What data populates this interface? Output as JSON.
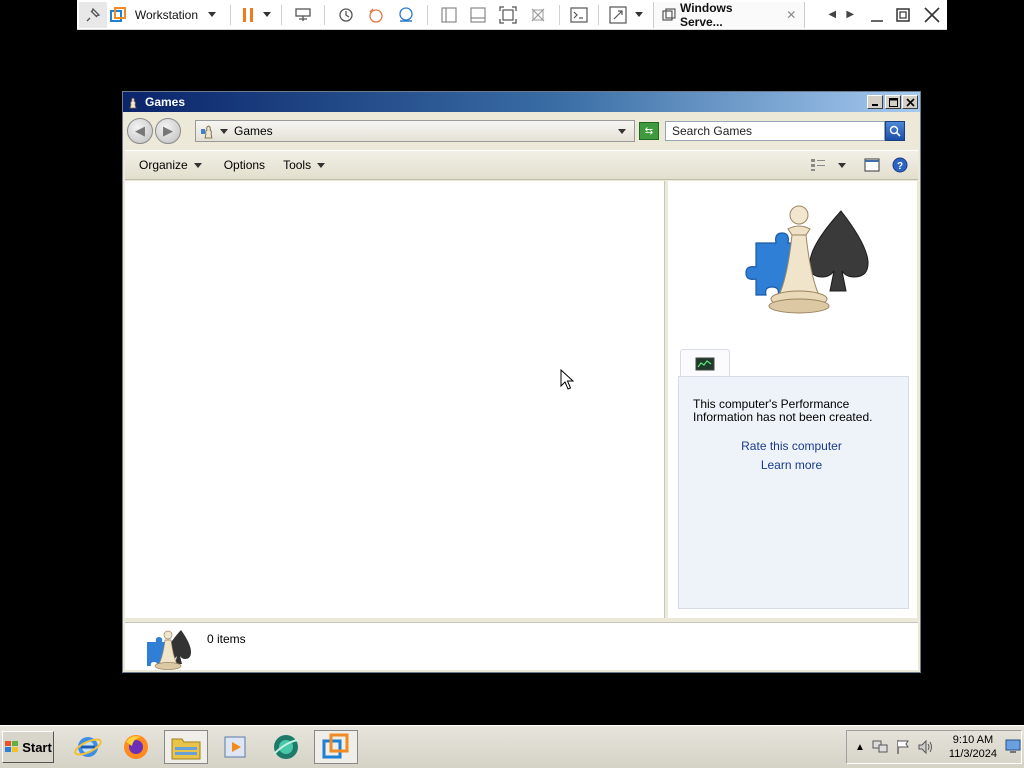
{
  "vmware": {
    "workstation_label": "Workstation",
    "vm_tab_label": "Windows Serve...",
    "tab_close": "✕"
  },
  "window": {
    "title": "Games",
    "address": "Games",
    "search_placeholder": "Search Games",
    "commands": {
      "organize": "Organize",
      "options": "Options",
      "tools": "Tools"
    }
  },
  "perf_panel": {
    "message": "This computer's Performance Information has not been created.",
    "rate_link": "Rate this computer",
    "learn_link": "Learn more"
  },
  "status": {
    "items": "0 items"
  },
  "taskbar": {
    "start_label": "Start",
    "time": "9:10 AM",
    "date": "11/3/2024"
  }
}
